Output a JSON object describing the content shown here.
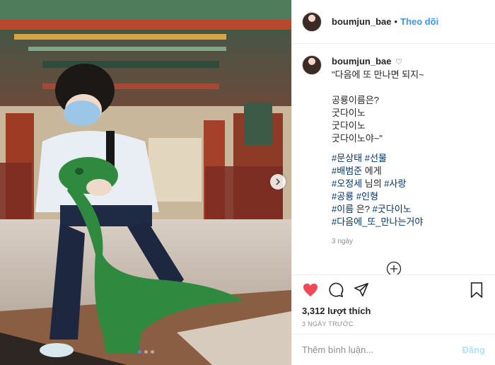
{
  "post": {
    "username": "boumjun_bae",
    "follow_label": "Theo dõi",
    "separator": "•",
    "verified_icon": "heart-outline-icon",
    "caption_lines": [
      "\"다음에 또 만나면 되지~",
      "",
      "공룡이름은?",
      "굿다이노",
      "굿다이노",
      "굿다이노야~\""
    ],
    "hashtag_lines": [
      {
        "parts": [
          {
            "text": "#문상태",
            "tag": true
          },
          {
            "text": " ",
            "tag": false
          },
          {
            "text": "#선물",
            "tag": true
          }
        ]
      },
      {
        "parts": [
          {
            "text": "#배범준",
            "tag": true
          },
          {
            "text": " 에게",
            "tag": false
          }
        ]
      },
      {
        "parts": [
          {
            "text": "#오정세",
            "tag": true
          },
          {
            "text": " 님의 ",
            "tag": false
          },
          {
            "text": "#사랑",
            "tag": true
          }
        ]
      },
      {
        "parts": [
          {
            "text": "#공룡",
            "tag": true
          },
          {
            "text": " ",
            "tag": false
          },
          {
            "text": "#인형",
            "tag": true
          }
        ]
      },
      {
        "parts": [
          {
            "text": "#이름",
            "tag": true
          },
          {
            "text": " 은? ",
            "tag": false
          },
          {
            "text": "#굿다이노",
            "tag": true
          }
        ]
      },
      {
        "parts": [
          {
            "text": "#다음에_또_만나는거야",
            "tag": true
          }
        ]
      }
    ],
    "caption_age": "3 ngày",
    "likes_text": "3,312 lượt thích",
    "date_text": "3 NGÀY TRƯỚC",
    "comment_placeholder": "Thêm bình luận...",
    "post_label": "Đăng",
    "carousel": {
      "count": 3,
      "active": 0
    }
  },
  "colors": {
    "like": "#ed4956",
    "link": "#3897f0",
    "hashtag": "#003569",
    "muted": "#8e8e8e",
    "post_disabled": "#b2dffc"
  },
  "icons": {
    "like": "heart-filled-icon",
    "comment": "comment-bubble-icon",
    "share": "paper-plane-icon",
    "save": "bookmark-icon",
    "load_more": "plus-circle-icon",
    "next": "chevron-right-icon"
  }
}
